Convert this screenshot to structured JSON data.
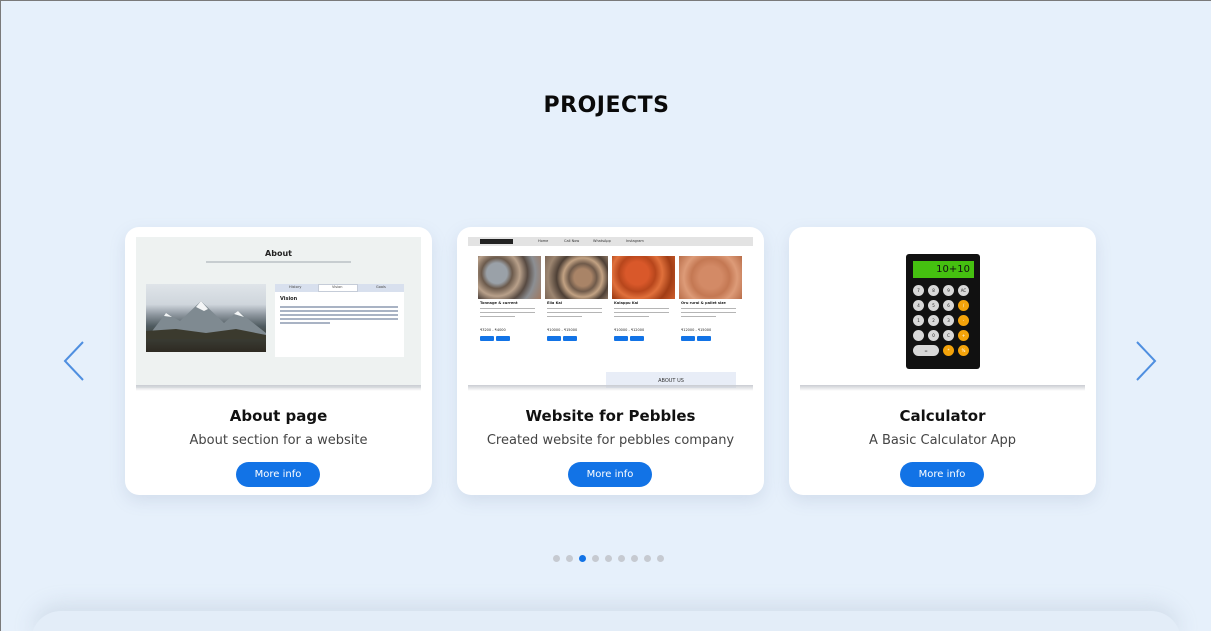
{
  "section": {
    "title": "PROJECTS"
  },
  "carousel": {
    "prev_icon": "chevron-left-icon",
    "next_icon": "chevron-right-icon",
    "accent_color": "#1273e6",
    "dot_count": 9,
    "active_dot": 2
  },
  "cards": [
    {
      "title": "About page",
      "description": "About section for a website",
      "button_label": "More info",
      "thumbnail": {
        "heading": "About",
        "tabs": [
          "History",
          "Vision",
          "Goals"
        ],
        "panel_title": "Vision"
      }
    },
    {
      "title": "Website for Pebbles",
      "description": "Created website for pebbles company",
      "button_label": "More info",
      "thumbnail": {
        "nav": [
          "Home",
          "Call Now",
          "WhatsApp",
          "Instagram"
        ],
        "products": [
          {
            "name": "Tonnage & current",
            "price": "₹3200 - ₹4000"
          },
          {
            "name": "Ella Kal",
            "price": "₹10000 - ₹15000"
          },
          {
            "name": "Kalappu Kal",
            "price": "₹10000 - ₹12000"
          },
          {
            "name": "Oru rural & pallet size",
            "price": "₹12000 - ₹15000"
          }
        ],
        "mini_buttons": [
          "Call now",
          "Details"
        ],
        "about_label": "ABOUT US"
      }
    },
    {
      "title": "Calculator",
      "description": "A Basic Calculator App",
      "button_label": "More info",
      "thumbnail": {
        "display": "10+10",
        "keys": [
          "7",
          "8",
          "9",
          "AC",
          "4",
          "5",
          "6",
          "/",
          "1",
          "2",
          "3",
          "-",
          "",
          "0",
          "C",
          "+",
          "=",
          "*",
          "%"
        ]
      }
    }
  ]
}
